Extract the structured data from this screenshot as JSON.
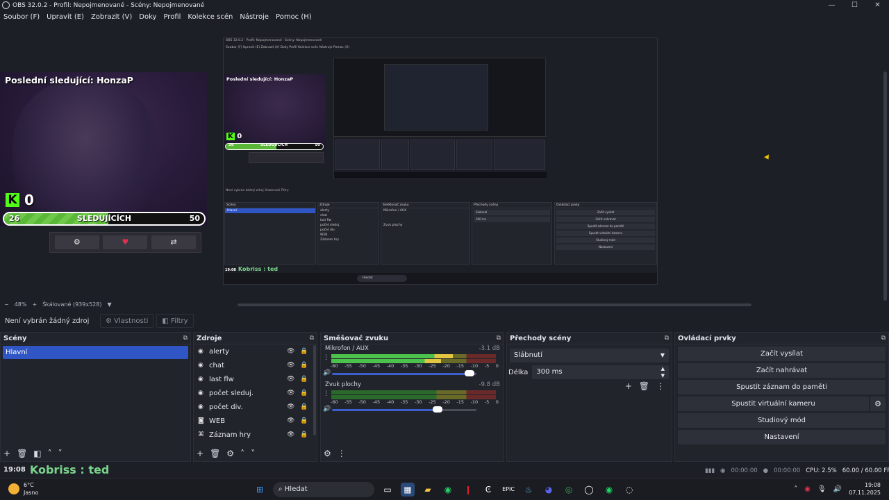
{
  "window": {
    "title": "OBS 32.0.2 - Profil: Nepojmenované - Scény: Nepojmenované",
    "min": "—",
    "max": "☐",
    "close": "✕"
  },
  "menu": [
    "Soubor (F)",
    "Upravit (E)",
    "Zobrazit (V)",
    "Doky",
    "Profil",
    "Kolekce scén",
    "Nástroje",
    "Pomoc (H)"
  ],
  "overlay": {
    "title": "Poslední sledující: HonzaP",
    "kick_logo": "K",
    "kick_count": "0",
    "goal_current": "26",
    "goal_label": "SLEDUJÍCÍCH",
    "goal_target": "50",
    "goal_fraction": 0.52,
    "buttons": [
      "⚙",
      "♥",
      "⇄"
    ]
  },
  "nested": {
    "title": "OBS 32.0.2 - Profil: Nepojmenované - Scény: Nepojmenované",
    "menu": "Soubor (F)   Upravit (E)   Zobrazit (V)   Doky   Profil   Kolekce scén   Nástroje   Pomoc (H)",
    "cam_title": "Poslední sledující: HonzaP",
    "kick_count": "0",
    "goal_lo": "26",
    "goal_mid": "SLEDUJÍCÍCH",
    "goal_hi": "50",
    "toolbar": "Není vybrán žádný zdroj      Vlastnosti      Filtry",
    "docks": {
      "scenes_h": "Scény",
      "scene_sel": "Hlavní",
      "sources_h": "Zdroje",
      "sources": [
        "alerty",
        "chat",
        "last flw",
        "počet sleduj.",
        "počet div.",
        "WEB",
        "Záznam hry"
      ],
      "mixer_h": "Směšovač zvuku",
      "mixer_a": "Mikrofon / AUX",
      "mixer_b": "Zvuk plochy",
      "trans_h": "Přechody scény",
      "trans_sel": "Slábnutí",
      "trans_dur": "300 ms",
      "ctrl_h": "Ovládací prvky",
      "ctrl": [
        "Začít vysílat",
        "Začít nahrávat",
        "Spustit záznam do paměti",
        "Spustit virtuální kameru",
        "Studiový mód",
        "Nastavení"
      ]
    },
    "clock_time": "19:08",
    "clock_text": "Kobriss : ted",
    "search": "Hledat"
  },
  "zoom": {
    "minus": "−",
    "value": "48%",
    "plus": "+",
    "scaling": "Škálované (939x528)",
    "dropdown": "▼"
  },
  "source_toolbar": {
    "no_source": "Není vybrán žádný zdroj",
    "properties": "⚙ Vlastnosti",
    "filters": "◧ Filtry"
  },
  "docks": {
    "scenes": {
      "title": "Scény",
      "items": [
        "Hlavní"
      ]
    },
    "sources": {
      "title": "Zdroje",
      "items": [
        {
          "icon": "◉",
          "label": "alerty"
        },
        {
          "icon": "◉",
          "label": "chat"
        },
        {
          "icon": "◉",
          "label": "last flw"
        },
        {
          "icon": "◉",
          "label": "počet sleduj."
        },
        {
          "icon": "◉",
          "label": "počet div."
        },
        {
          "icon": "◙",
          "label": "WEB"
        },
        {
          "icon": "⌘",
          "label": "Záznam hry"
        }
      ]
    },
    "mixer": {
      "title": "Směšovač zvuku",
      "channels": [
        {
          "name": "Mikrofon / AUX",
          "db": "-3.1 dB",
          "level": 0.74,
          "volume": 0.95
        },
        {
          "name": "Zvuk plochy",
          "db": "-9.8 dB",
          "level": 0.0,
          "volume": 0.73
        }
      ],
      "scale": [
        "-60",
        "-55",
        "-50",
        "-45",
        "-40",
        "-35",
        "-30",
        "-25",
        "-20",
        "-15",
        "-10",
        "-5",
        "0"
      ]
    },
    "transitions": {
      "title": "Přechody scény",
      "selected": "Slábnutí",
      "duration_label": "Délka",
      "duration_value": "300 ms"
    },
    "controls": {
      "title": "Ovládací prvky",
      "buttons": [
        "Začít vysílat",
        "Začít nahrávat",
        "Spustit záznam do paměti",
        "Spustit virtuální kameru",
        "Studiový mód",
        "Nastavení"
      ]
    }
  },
  "clock": {
    "time": "19:08",
    "text": "Kobriss : ted"
  },
  "status": {
    "rec_time": "00:00:00",
    "stream_time": "00:00:00",
    "cpu": "CPU: 2.5%",
    "fps": "60.00 / 60.00 FPS"
  },
  "taskbar": {
    "temp": "6°C",
    "weather": "Jasno",
    "search": "Hledat",
    "time": "19:08",
    "date": "07.11.2025"
  },
  "colors": {
    "accent": "#2f56c4",
    "kick_green": "#53fc18",
    "clock_green": "#7bd48c"
  }
}
